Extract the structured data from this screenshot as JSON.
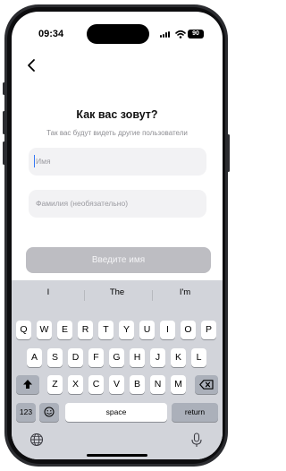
{
  "status_bar": {
    "time": "09:34",
    "battery": "90"
  },
  "header": {
    "title": "Как вас зовут?",
    "subtitle": "Так вас будут видеть другие пользователи"
  },
  "form": {
    "first_name_placeholder": "Имя",
    "last_name_placeholder": "Фамилия (необязательно)",
    "submit_label": "Введите имя"
  },
  "keyboard": {
    "suggestions": [
      "I",
      "The",
      "I'm"
    ],
    "row1": [
      "Q",
      "W",
      "E",
      "R",
      "T",
      "Y",
      "U",
      "I",
      "O",
      "P"
    ],
    "row2": [
      "A",
      "S",
      "D",
      "F",
      "G",
      "H",
      "J",
      "K",
      "L"
    ],
    "row3": [
      "Z",
      "X",
      "C",
      "V",
      "B",
      "N",
      "M"
    ],
    "numbers_label": "123",
    "space_label": "space",
    "return_label": "return"
  },
  "colors": {
    "accent": "#3478f6",
    "disabled_button": "#bdbdc2"
  }
}
